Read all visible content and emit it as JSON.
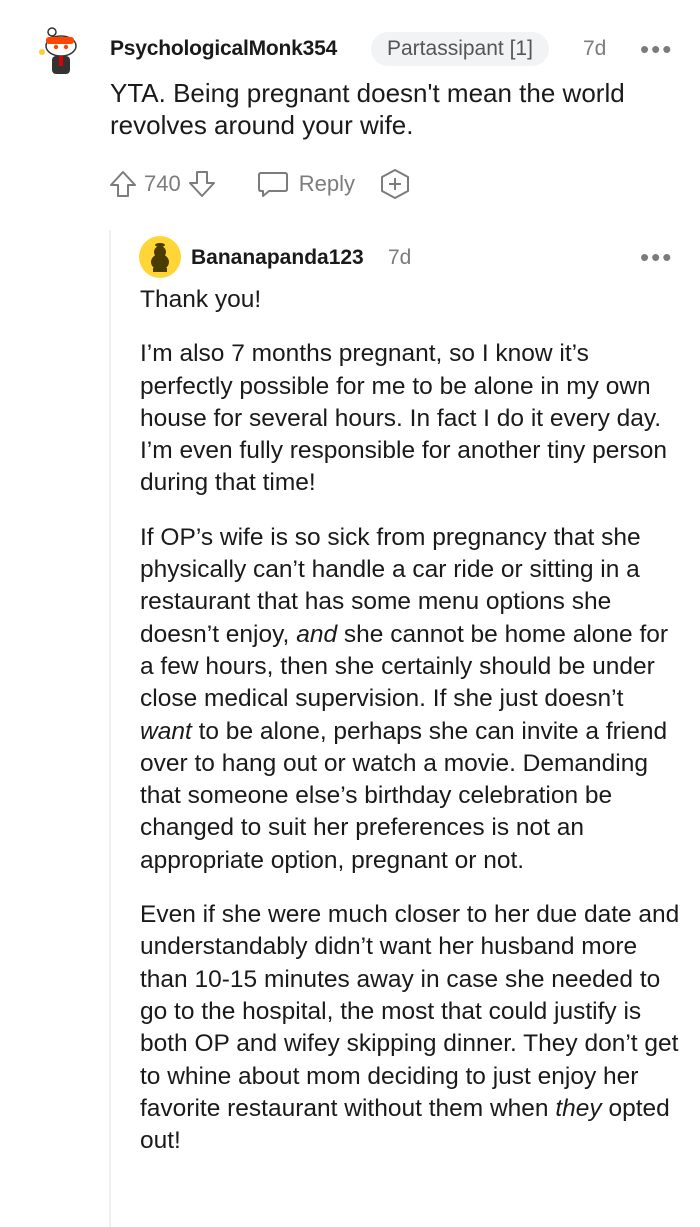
{
  "parent_comment": {
    "username": "PsychologicalMonk354",
    "flair": "Partassipant [1]",
    "time": "7d",
    "more": "•••",
    "body": "YTA. Being pregnant doesn't mean the world revolves around your wife.",
    "score": "740",
    "reply_label": "Reply"
  },
  "reply_comment": {
    "username": "Bananapanda123",
    "time": "7d",
    "more": "•••",
    "p1": "Thank you!",
    "p2": "I’m also 7 months pregnant, so I know it’s perfectly possible for me to be alone in my own house for several hours. In fact I do it every day. I’m even fully responsible for another tiny person during that time!",
    "p3_a": "If OP’s wife is so sick from pregnancy that she physically can’t handle a car ride or sitting in a restaurant that has some menu options she doesn’t enjoy, ",
    "p3_b": "and",
    "p3_c": " she cannot be home alone for a few hours, then she certainly should be under close medical supervision. If she just doesn’t ",
    "p3_d": "want",
    "p3_e": " to be alone, perhaps she can invite a friend over to hang out or watch a movie. Demanding that someone else’s birthday celebration be changed to suit her preferences is not an appropriate option, pregnant or not.",
    "p4_a": "Even if she were much closer to her due date and understandably didn’t want her husband more than 10-15 minutes away in case she needed to go to the hospital, the most that could justify is both OP and wifey skipping dinner. They don’t get to whine about mom deciding to just enjoy her favorite restaurant without them when ",
    "p4_b": "they",
    "p4_c": " opted out!"
  },
  "icons": {
    "upvote": "arrow-up-icon",
    "downvote": "arrow-down-icon",
    "reply": "speech-bubble-icon",
    "award": "award-plus-icon",
    "more": "more-dots-icon"
  },
  "colors": {
    "text": "#1a1a1b",
    "muted": "#7c7c7c",
    "flair_bg": "#f1f3f4",
    "thread_line": "#edeff1"
  }
}
